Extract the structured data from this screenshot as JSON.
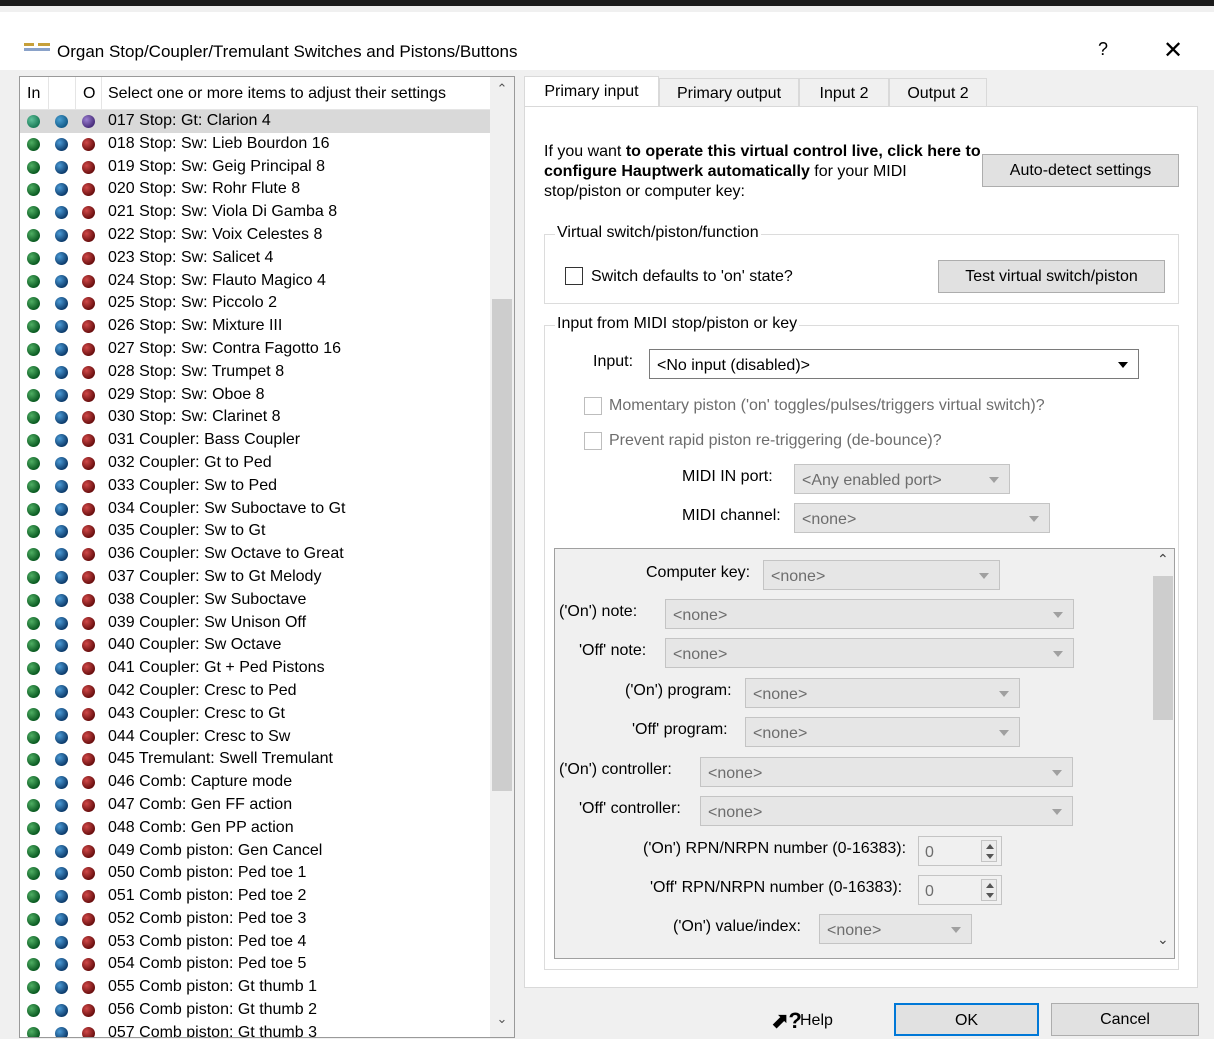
{
  "window": {
    "title": "Organ Stop/Coupler/Tremulant Switches and Pistons/Buttons",
    "help_glyph": "?",
    "close_glyph": "✕"
  },
  "list": {
    "headers": {
      "in": "In",
      "o": "O",
      "select": "Select one or more items to adjust their settings"
    },
    "items": [
      "017 Stop: Gt: Clarion 4",
      "018 Stop: Sw: Lieb Bourdon 16",
      "019 Stop: Sw: Geig Principal 8",
      "020 Stop: Sw: Rohr Flute 8",
      "021 Stop: Sw: Viola Di Gamba 8",
      "022 Stop: Sw: Voix Celestes 8",
      "023 Stop: Sw: Salicet 4",
      "024 Stop: Sw: Flauto Magico 4",
      "025 Stop: Sw: Piccolo 2",
      "026 Stop: Sw: Mixture III",
      "027 Stop: Sw: Contra Fagotto 16",
      "028 Stop: Sw: Trumpet 8",
      "029 Stop: Sw: Oboe 8",
      "030 Stop: Sw: Clarinet 8",
      "031 Coupler: Bass Coupler",
      "032 Coupler: Gt to Ped",
      "033 Coupler: Sw to Ped",
      "034 Coupler: Sw Suboctave to Gt",
      "035 Coupler: Sw to Gt",
      "036 Coupler: Sw Octave to Great",
      "037 Coupler: Sw to Gt Melody",
      "038 Coupler: Sw Suboctave",
      "039 Coupler: Sw Unison Off",
      "040 Coupler: Sw Octave",
      "041 Coupler: Gt + Ped Pistons",
      "042 Coupler: Cresc to Ped",
      "043 Coupler: Cresc to Gt",
      "044 Coupler: Cresc to Sw",
      "045 Tremulant: Swell Tremulant",
      "046 Comb: Capture mode",
      "047 Comb: Gen FF action",
      "048 Comb: Gen PP action",
      "049 Comb piston: Gen Cancel",
      "050 Comb piston: Ped toe 1",
      "051 Comb piston: Ped toe 2",
      "052 Comb piston: Ped toe 3",
      "053 Comb piston: Ped toe 4",
      "054 Comb piston: Ped toe 5",
      "055 Comb piston: Gt thumb 1",
      "056 Comb piston: Gt thumb 2",
      "057 Comb piston: Gt thumb 3"
    ]
  },
  "tabs": [
    "Primary input",
    "Primary output",
    "Input 2",
    "Output 2"
  ],
  "primary_input": {
    "intro_plain1": "If you want ",
    "intro_bold": "to operate this virtual control live, click here to configure Hauptwerk automatically",
    "intro_plain2": " for your MIDI stop/piston or computer key:",
    "auto_detect": "Auto-detect settings",
    "virtual_group": "Virtual switch/piston/function",
    "switch_defaults": "Switch defaults to 'on' state?",
    "test_button": "Test virtual switch/piston",
    "midi_group": "Input from MIDI stop/piston or key",
    "input_label": "Input:",
    "input_value": "<No input (disabled)>",
    "momentary": "Momentary piston ('on' toggles/pulses/triggers virtual switch)?",
    "debounce": "Prevent rapid piston re-triggering (de-bounce)?",
    "midi_port_label": "MIDI IN port:",
    "midi_port_value": "<Any enabled port>",
    "midi_channel_label": "MIDI channel:",
    "midi_channel_value": "<none>",
    "computer_key_label": "Computer key:",
    "computer_key_value": "<none>",
    "on_note_label": "('On') note:",
    "on_note_value": "<none>",
    "off_note_label": "'Off' note:",
    "off_note_value": "<none>",
    "on_program_label": "('On') program:",
    "on_program_value": "<none>",
    "off_program_label": "'Off' program:",
    "off_program_value": "<none>",
    "on_controller_label": "('On') controller:",
    "on_controller_value": "<none>",
    "off_controller_label": "'Off' controller:",
    "off_controller_value": "<none>",
    "on_rpn_label": "('On') RPN/NRPN number (0-16383):",
    "on_rpn_value": "0",
    "off_rpn_label": "'Off' RPN/NRPN number (0-16383):",
    "off_rpn_value": "0",
    "on_value_label": "('On') value/index:",
    "on_value_value": "<none>"
  },
  "buttons": {
    "help": "Help",
    "ok": "OK",
    "cancel": "Cancel"
  }
}
